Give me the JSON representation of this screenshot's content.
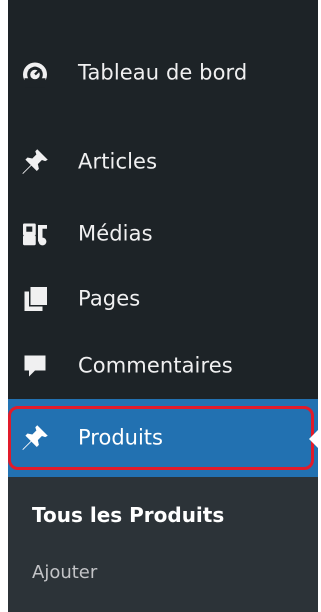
{
  "colors": {
    "sidebar_bg": "#1d2327",
    "submenu_bg": "#2c3338",
    "active_bg": "#2271b1",
    "text": "#f0f0f1",
    "icon": "#f0f0f1",
    "muted_text": "#c3c4c7",
    "highlight_border": "#e11b2a"
  },
  "menu": {
    "items": [
      {
        "label": "Tableau de bord",
        "icon": "dashboard-icon"
      },
      {
        "label": "Articles",
        "icon": "pin-icon"
      },
      {
        "label": "Médias",
        "icon": "media-icon"
      },
      {
        "label": "Pages",
        "icon": "pages-icon"
      },
      {
        "label": "Commentaires",
        "icon": "comment-icon"
      }
    ],
    "active": {
      "label": "Produits",
      "icon": "pin-icon"
    },
    "submenu": [
      {
        "label": "Tous les Produits",
        "current": true
      },
      {
        "label": "Ajouter",
        "current": false
      }
    ]
  }
}
